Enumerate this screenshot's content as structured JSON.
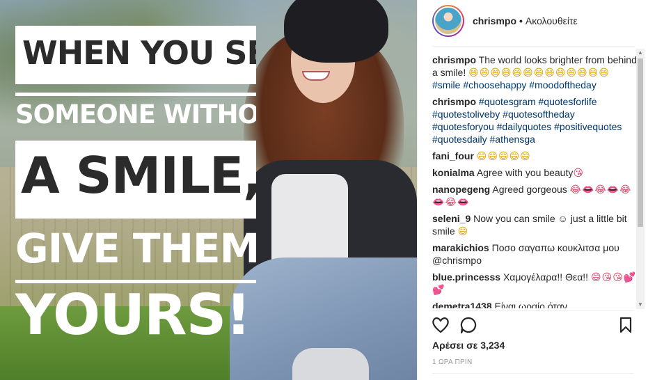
{
  "post": {
    "image": {
      "quote_lines": [
        "WHEN YOU SEE",
        "SOMEONE WITHOUT",
        "A SMILE,",
        "GIVE THEM",
        "YOURS!"
      ]
    }
  },
  "header": {
    "username": "chrismpo",
    "separator": "•",
    "follow_label": "Ακολουθείτε"
  },
  "comments": [
    {
      "user": "chrismpo",
      "text": "The world looks brighter from behind a smile!",
      "emoji": "😄😄😄😄😄😄😄😄😄😄😄😄😄",
      "tags": "#smile #choosehappy #moodoftheday"
    },
    {
      "user": "chrismpo",
      "text": "",
      "emoji": "",
      "tags": "#quotesgram #quotesforlife #quotestoliveby #quotesoftheday #quotesforyou #dailyquotes #positivequotes #quotesdaily #athensga"
    },
    {
      "user": "fani_four",
      "text": "",
      "emoji": "😄😄😄😄😄",
      "tags": ""
    },
    {
      "user": "konialma",
      "text": "Agree with you beauty",
      "emoji": "😘",
      "tags": ""
    },
    {
      "user": "nanopegeng",
      "text": "Agreed gorgeous",
      "emoji": "😂👄😂👄😂👄😂👄",
      "tags": ""
    },
    {
      "user": "seleni_9",
      "text": "Now you can smile ☺ just a little bit smile",
      "emoji": "😄",
      "tags": ""
    },
    {
      "user": "marakichios",
      "text": "Ποσο σαγαπω κουκλιτσα μου @chrismpo",
      "emoji": "",
      "tags": ""
    },
    {
      "user": "blue.princesss",
      "text": "Χαμογέλαρα!! Θεα!!",
      "emoji": "😄😘😘💕💕",
      "tags": ""
    },
    {
      "user": "demetra1438",
      "text": "Είναι ωραίο όταν",
      "emoji": "",
      "tags": ""
    }
  ],
  "footer": {
    "likes": "Αρέσει σε 3,234",
    "time": "1 ΩΡΑ ΠΡΙΝ"
  },
  "icons": {
    "like": "heart-outline-icon",
    "comment": "speech-bubble-icon",
    "save": "bookmark-icon"
  }
}
